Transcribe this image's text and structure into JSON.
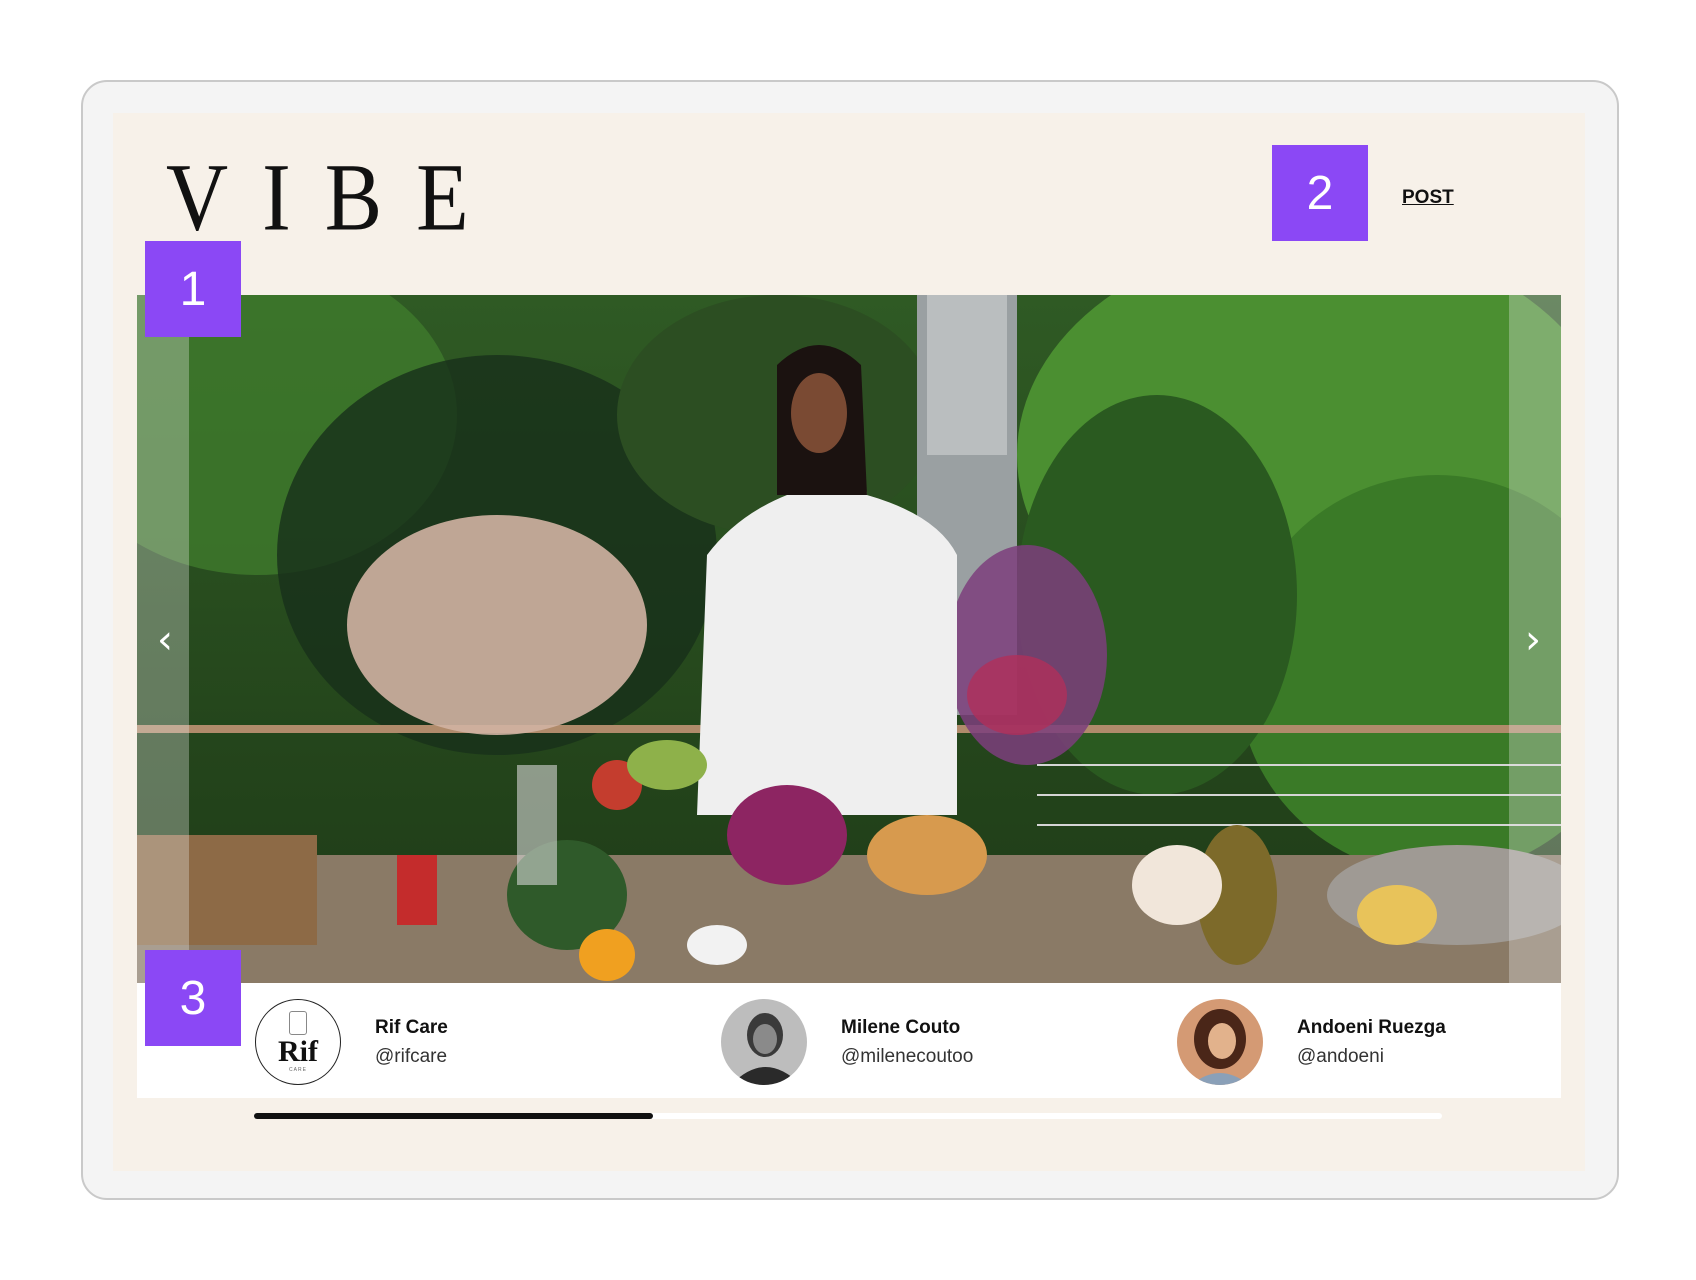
{
  "brand": {
    "logo_text": "VIBE"
  },
  "nav": {
    "post_label": "POST"
  },
  "hero": {
    "prev_glyph": "‹",
    "next_glyph": "›",
    "image_icon": "photo-lifestyle-table"
  },
  "profiles": [
    {
      "name": "Rif Care",
      "handle": "@rifcare",
      "avatar_text": "Rif",
      "avatar_sub": "CARE"
    },
    {
      "name": "Milene Couto",
      "handle": "@milenecoutoo"
    },
    {
      "name": "Andoeni Ruezga",
      "handle": "@andoeni"
    }
  ],
  "progress": {
    "value_fraction": 0.336
  },
  "badges": [
    "1",
    "2",
    "3"
  ],
  "colors": {
    "accent": "#8b48f5",
    "background": "#f7f1e9",
    "text": "#111111"
  }
}
